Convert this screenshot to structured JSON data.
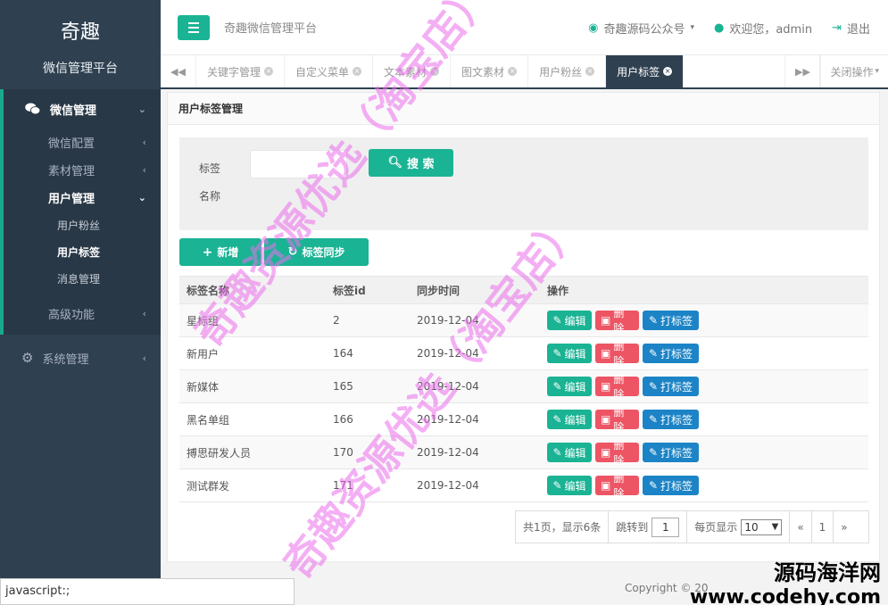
{
  "sidebar": {
    "brand_name": "奇趣",
    "brand_sub": "微信管理平台",
    "group_label": "微信管理",
    "items": [
      {
        "label": "微信配置"
      },
      {
        "label": "素材管理"
      },
      {
        "label": "用户管理"
      }
    ],
    "sub_items": [
      {
        "label": "用户粉丝"
      },
      {
        "label": "用户标签"
      },
      {
        "label": "消息管理"
      }
    ],
    "advanced_label": "高级功能",
    "system_label": "系统管理"
  },
  "topbar": {
    "title": "奇趣微信管理平台",
    "official": "奇趣源码公众号",
    "welcome": "欢迎您，admin",
    "logout": "退出"
  },
  "tabs": {
    "items": [
      {
        "label": "关键字管理"
      },
      {
        "label": "自定义菜单"
      },
      {
        "label": "文本素材"
      },
      {
        "label": "图文素材"
      },
      {
        "label": "用户粉丝"
      },
      {
        "label": "用户标签"
      }
    ],
    "close_ops": "关闭操作"
  },
  "panel": {
    "title": "用户标签管理",
    "search_label": "标签名称",
    "search_btn": "搜 索",
    "add_btn": "新增",
    "sync_btn": "标签同步"
  },
  "table": {
    "headers": [
      "标签名称",
      "标签id",
      "同步时间",
      "操作"
    ],
    "rows": [
      {
        "name": "星标组",
        "id": "2",
        "time": "2019-12-04"
      },
      {
        "name": "新用户",
        "id": "164",
        "time": "2019-12-04"
      },
      {
        "name": "新媒体",
        "id": "165",
        "time": "2019-12-04"
      },
      {
        "name": "黑名单组",
        "id": "166",
        "time": "2019-12-04"
      },
      {
        "name": "搏思研发人员",
        "id": "170",
        "time": "2019-12-04"
      },
      {
        "name": "测试群发",
        "id": "171",
        "time": "2019-12-04"
      }
    ],
    "edit_label": "编辑",
    "delete_label": "删除",
    "tag_label": "打标签"
  },
  "pager": {
    "summary": "共1页，显示6条",
    "jump_label": "跳转到",
    "jump_value": "1",
    "per_page_label": "每页显示",
    "per_page_value": "10",
    "prev": "«",
    "current": "1",
    "next": "»"
  },
  "status": {
    "url": "javascript:;",
    "copyright": "Copyright © 20"
  },
  "watermark": {
    "line1": "奇趣资源优选（淘宝店）",
    "line2": "奇趣资源优选（淘宝店）",
    "site_cn": "源码海洋网",
    "site_url": "www.codehy.com"
  },
  "colors": {
    "sidebar": "#2f4050",
    "primary": "#1ab394",
    "danger": "#ed5565",
    "info": "#1c84c6"
  }
}
